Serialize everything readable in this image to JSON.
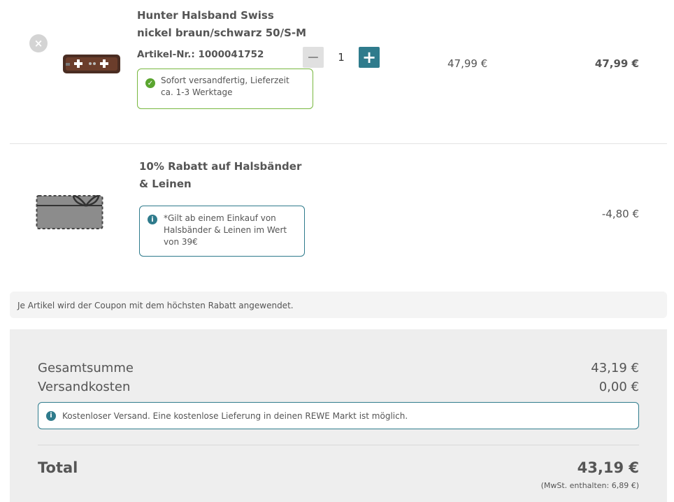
{
  "item": {
    "remove_glyph": "×",
    "title_line1": "Hunter Halsband Swiss",
    "title_line2": "nickel braun/schwarz 50/S-M",
    "artnr_label": "Artikel-Nr.:",
    "artnr_value": "1000041752",
    "availability_line1": "Sofort versandfertig, Lieferzeit",
    "availability_line2": "ca. 1-3 Werktage",
    "quantity": "1",
    "unit_price": "47,99 €",
    "total_price": "47,99 €"
  },
  "coupon": {
    "title_line1": "10% Rabatt auf Halsbänder",
    "title_line2": "& Leinen",
    "info_line1": "*Gilt ab einem Einkauf von",
    "info_line2": "Halsbänder & Leinen im Wert",
    "info_line3": "von 39€",
    "discount": "-4,80 €"
  },
  "coupon_note": "Je Artikel wird der Coupon mit dem höchsten Rabatt angewendet.",
  "summary": {
    "subtotal_label": "Gesamtsumme",
    "subtotal_value": "43,19 €",
    "shipping_label": "Versandkosten",
    "shipping_value": "0,00 €",
    "shipping_info": "Kostenloser Versand. Eine kostenlose Lieferung in deinen REWE Markt ist möglich.",
    "total_label": "Total",
    "total_value": "43,19 €",
    "vat_note": "(MwSt. enthalten: 6,89 €)"
  },
  "colors": {
    "accent": "#2f7b8c",
    "success": "#5aa52f"
  },
  "icons": {
    "remove": "close-circle-icon",
    "check": "check-circle-icon",
    "info": "info-circle-icon",
    "minus": "minus-icon",
    "plus": "plus-icon",
    "gift": "gift-card-icon"
  }
}
